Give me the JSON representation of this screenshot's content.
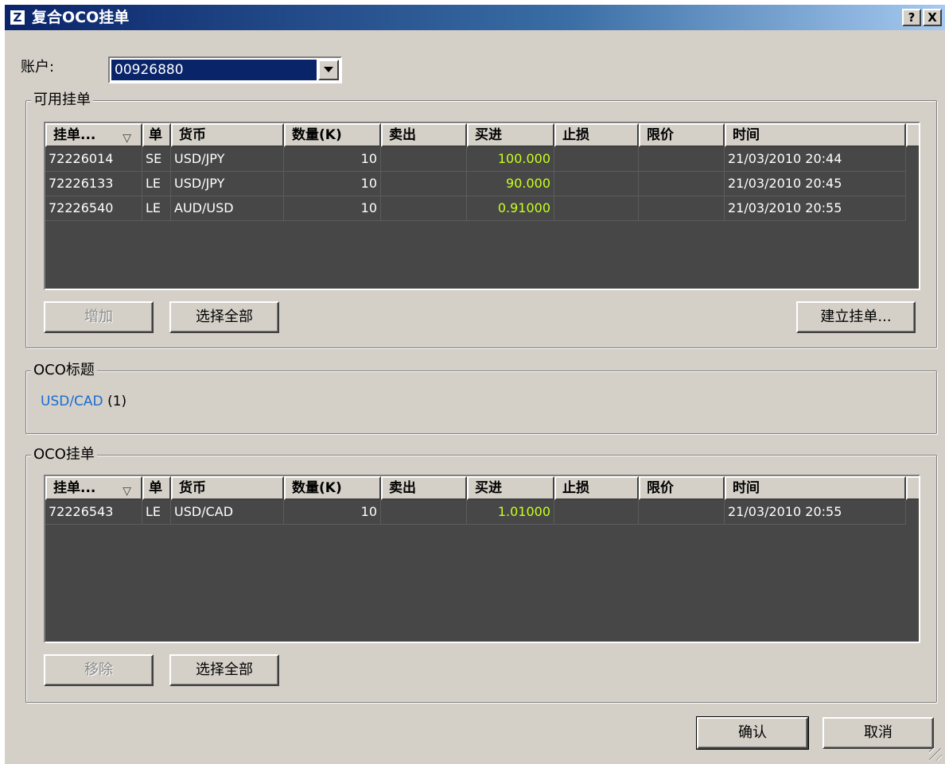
{
  "window": {
    "title": "复合OCO挂单",
    "help_label": "?",
    "close_label": "X"
  },
  "account": {
    "label": "账户:",
    "value": "00926880"
  },
  "available": {
    "group_title": "可用挂单",
    "columns": [
      "挂单...",
      "单",
      "货币",
      "数量(K)",
      "卖出",
      "买进",
      "止损",
      "限价",
      "时间"
    ],
    "sort_icon": "▽",
    "rows": [
      {
        "id": "72226014",
        "type": "SE",
        "currency": "USD/JPY",
        "qty": "10",
        "sell": "",
        "buy": "100.000",
        "stop": "",
        "limit": "",
        "time": "21/03/2010 20:44"
      },
      {
        "id": "72226133",
        "type": "LE",
        "currency": "USD/JPY",
        "qty": "10",
        "sell": "",
        "buy": "90.000",
        "stop": "",
        "limit": "",
        "time": "21/03/2010 20:45"
      },
      {
        "id": "72226540",
        "type": "LE",
        "currency": "AUD/USD",
        "qty": "10",
        "sell": "",
        "buy": "0.91000",
        "stop": "",
        "limit": "",
        "time": "21/03/2010 20:55"
      }
    ],
    "add_button": "增加",
    "select_all_button": "选择全部",
    "create_button": "建立挂单..."
  },
  "oco_title": {
    "group_title": "OCO标题",
    "link_text": "USD/CAD",
    "count_text": "(1)"
  },
  "oco_orders": {
    "group_title": "OCO挂单",
    "columns": [
      "挂单...",
      "单",
      "货币",
      "数量(K)",
      "卖出",
      "买进",
      "止损",
      "限价",
      "时间"
    ],
    "sort_icon": "▽",
    "rows": [
      {
        "id": "72226543",
        "type": "LE",
        "currency": "USD/CAD",
        "qty": "10",
        "sell": "",
        "buy": "1.01000",
        "stop": "",
        "limit": "",
        "time": "21/03/2010 20:55"
      }
    ],
    "remove_button": "移除",
    "select_all_button": "选择全部"
  },
  "footer": {
    "ok_button": "确认",
    "cancel_button": "取消"
  },
  "colors": {
    "grid_bg": "#474747",
    "buy_value": "#c8ff1e",
    "link": "#1a6bd0",
    "title_bar": "#0a246a"
  }
}
